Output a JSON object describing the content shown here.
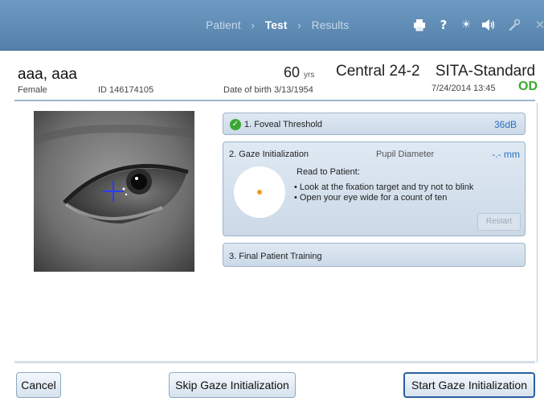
{
  "nav": {
    "crumbs": [
      "Patient",
      "Test",
      "Results"
    ],
    "separator": "›",
    "active": "Test",
    "icons": [
      "printer-icon",
      "help-icon",
      "brightness-icon",
      "volume-icon",
      "wrench-icon",
      "close-icon"
    ],
    "icon_glyphs": {
      "help": "?",
      "brightness": "☀",
      "close": "✕"
    }
  },
  "patient": {
    "name": "aaa, aaa",
    "sex": "Female",
    "id_label": "ID 146174105",
    "age": "60",
    "age_unit": "yrs",
    "dob_label": "Date of birth",
    "dob": "3/13/1954"
  },
  "test": {
    "name": "Central 24-2",
    "strategy": "SITA-Standard",
    "datetime": "7/24/2014 13:45",
    "eye": "OD",
    "eye_color": "#3aa832"
  },
  "steps": {
    "foveal": {
      "label": "1. Foveal Threshold",
      "value": "36dB",
      "status": "complete",
      "check": "✓"
    },
    "gaze": {
      "label": "2. Gaze Initialization",
      "pupil_label": "Pupil Diameter",
      "pupil_value": "-.- mm",
      "read_label": "Read to Patient:",
      "instructions": [
        "• Look at the fixation target and try not to blink",
        "• Open your eye wide for a count of ten"
      ],
      "restart_label": "Restart"
    },
    "training": {
      "label": "3. Final Patient Training"
    }
  },
  "buttons": {
    "cancel": "Cancel",
    "skip": "Skip Gaze Initialization",
    "start": "Start Gaze Initialization"
  },
  "colors": {
    "accent": "#2a6fc2",
    "fixation_dot": "#f39a1e",
    "crosshair": "#2a3dff",
    "complete": "#3aa832"
  }
}
